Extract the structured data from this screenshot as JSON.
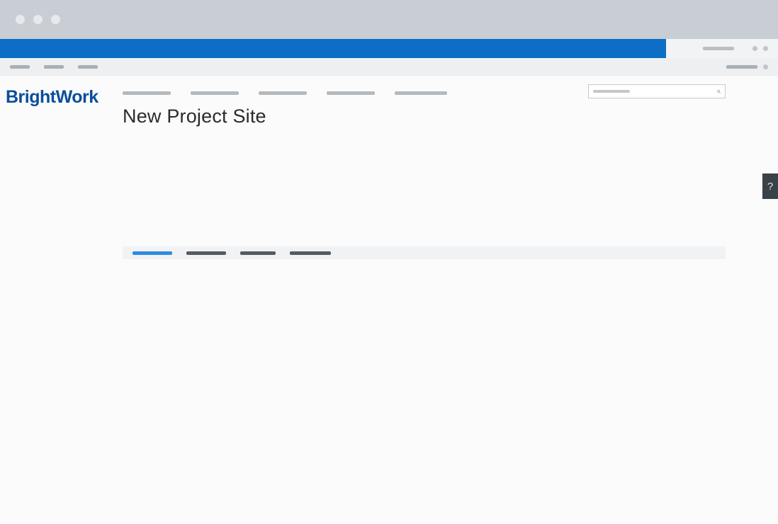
{
  "logo_text": "BrightWork",
  "page_title": "New Project Site",
  "help_label": "?",
  "search_icon": "⌕",
  "colors": {
    "brand_blue": "#0a4e9b",
    "suite_blue": "#0c6fc5",
    "tab_active": "#2f8ae2",
    "help_bg": "#3a4147"
  }
}
